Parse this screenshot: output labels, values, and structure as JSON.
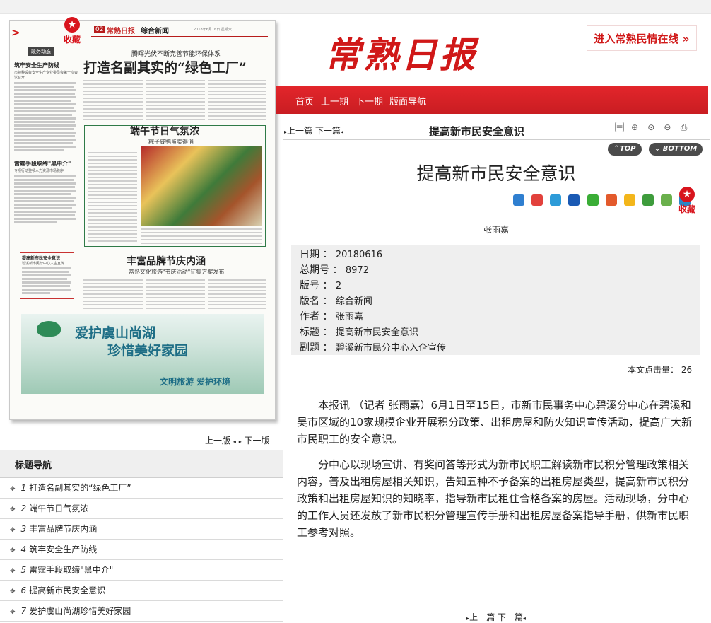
{
  "paper": {
    "page_number": "02",
    "brand": "常熟日报",
    "section": "综合新闻",
    "date_line": "2018年6月16日 星期六",
    "fav_label": "收藏",
    "left_column": {
      "section_label": "政务动态",
      "story1_title": "筑牢安全生产防线",
      "story1_sub": "市特种设备安全生产专业委员会第一次会议召开",
      "story2_title": "雷霆手段取缔\"黑中介\"",
      "story2_sub": "专项行动整顿人力资源市场秩序",
      "box_title": "提高新市民安全意识",
      "box_sub": "碧溪新市民分中心入企宣传"
    },
    "main_kicker": "腾晖光伏不断完善节能环保体系",
    "main_headline": "打造名副其实的“绿色工厂”",
    "story2_headline": "端午节日气氛浓",
    "story2_sub": "粽子咸鸭蛋卖得俏",
    "story3_headline": "丰富品牌节庆内涵",
    "story3_sub": "常熟文化旅游\"节庆活动\"征集方案发布",
    "ad_line1": "爱护虞山尚湖",
    "ad_line2": "珍惜美好家园",
    "ad_line3": "文明旅游 爱护环境"
  },
  "pager": {
    "prev": "上一版",
    "next": "下一版"
  },
  "nav": {
    "title": "标题导航",
    "items": [
      {
        "num": "1",
        "label": "打造名副其实的“绿色工厂”"
      },
      {
        "num": "2",
        "label": "端午节日气氛浓"
      },
      {
        "num": "3",
        "label": "丰富品牌节庆内涵"
      },
      {
        "num": "4",
        "label": "筑牢安全生产防线"
      },
      {
        "num": "5",
        "label": "雷霆手段取缔\"黑中介\""
      },
      {
        "num": "6",
        "label": "提高新市民安全意识"
      },
      {
        "num": "7",
        "label": "爱护虞山尚湖珍惜美好家园"
      }
    ]
  },
  "header": {
    "masthead": "常熟日报",
    "banner": "进入常熟民情在线",
    "menu": [
      "首页",
      "上一期",
      "下一期",
      "版面导航"
    ]
  },
  "article_bar": {
    "prev": "上一篇",
    "next": "下一篇",
    "title": "提高新市民安全意识",
    "top": "TOP",
    "bottom": "BOTTOM"
  },
  "article": {
    "title": "提高新市民安全意识",
    "author": "张雨嘉",
    "fav_label": "收藏",
    "meta": [
      {
        "label": "日期",
        "value": "20180616"
      },
      {
        "label": "总期号",
        "value": "8972"
      },
      {
        "label": "版号",
        "value": "2"
      },
      {
        "label": "版名",
        "value": "综合新闻"
      },
      {
        "label": "作者",
        "value": "张雨嘉"
      },
      {
        "label": "标题",
        "value": "提高新市民安全意识"
      },
      {
        "label": "副题",
        "value": "碧溪新市民分中心入企宣传"
      }
    ],
    "hits_label": "本文点击量：",
    "hits_value": "26",
    "paragraphs": [
      "本报讯 （记者 张雨嘉）6月1日至15日，市新市民事务中心碧溪分中心在碧溪和吴市区域的10家规模企业开展积分政策、出租房屋和防火知识宣传活动，提高广大新市民职工的安全意识。",
      "分中心以现场宣讲、有奖问答等形式为新市民职工解读新市民积分管理政策相关内容，普及出租房屋相关知识，告知五种不予备案的出租房屋类型，提高新市民积分政策和出租房屋知识的知晓率，指导新市民租住合格备案的房屋。活动现场，分中心的工作人员还发放了新市民积分管理宣传手册和出租房屋备案指导手册，供新市民职工参考对照。"
    ]
  },
  "colors": {
    "brand_red": "#d01818",
    "bar_red": "#e3262b"
  }
}
